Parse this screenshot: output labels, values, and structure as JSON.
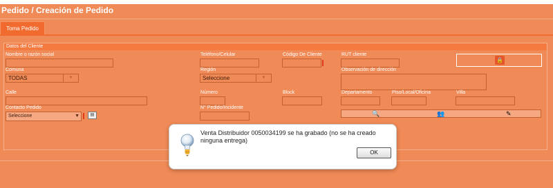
{
  "page": {
    "title": "Pedido / Creación de Pedido"
  },
  "tabs": [
    {
      "label": "Toma Pedido"
    }
  ],
  "panel": {
    "title": "Datos del Cliente",
    "labels": {
      "nombre": "Nombre o razón social",
      "telefono": "Teléfono/Celular",
      "codigo": "Código De Cliente",
      "rut": "RUT cliente",
      "comuna": "Comuna",
      "region": "Región",
      "observacion": "Observación de dirección",
      "calle": "Calle",
      "numero": "Número",
      "block": "Block",
      "departamento": "Departamento",
      "piso": "Piso/Local/Oficina",
      "villa": "Villa",
      "contacto": "Contacto Pedido",
      "pedido_incidente": "N° Pedido/Incidente"
    },
    "values": {
      "comuna": "TODAS",
      "region": "Seleccione",
      "contacto": "Seleccione"
    }
  },
  "icons": {
    "lock": "lock-icon",
    "calendar": "calendar-icon",
    "user_search": "user-search-icon",
    "user_group": "user-group-icon",
    "user_edit": "user-edit-icon",
    "lightbulb": "lightbulb-icon"
  },
  "dialog": {
    "message": "Venta Distribuidor 0050034199 se ha grabado (no se ha creado ninguna entrega)",
    "ok_label": "OK"
  },
  "colors": {
    "background": "#f08a57",
    "tab": "#f06b2d",
    "required": "#e03a1a",
    "dialog_bg": "#ffffff"
  }
}
